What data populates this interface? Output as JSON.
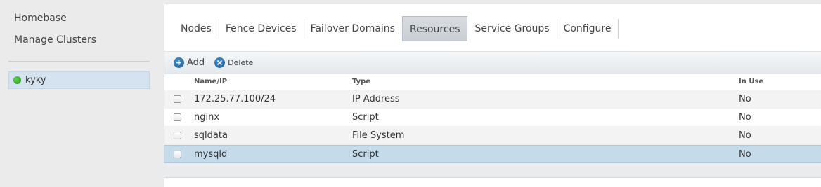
{
  "sidebar": {
    "links": [
      "Homebase",
      "Manage Clusters"
    ],
    "clusters": [
      {
        "name": "kyky",
        "status": "online"
      }
    ]
  },
  "tabs": [
    "Nodes",
    "Fence Devices",
    "Failover Domains",
    "Resources",
    "Service Groups",
    "Configure"
  ],
  "active_tab": "Resources",
  "toolbar": {
    "add_label": "Add",
    "add_icon": "plus-icon",
    "delete_label": "Delete",
    "delete_icon": "x-icon"
  },
  "table": {
    "columns": [
      "Name/IP",
      "Type",
      "In Use"
    ],
    "rows": [
      {
        "name": "172.25.77.100/24",
        "type": "IP Address",
        "in_use": "No"
      },
      {
        "name": "nginx",
        "type": "Script",
        "in_use": "No"
      },
      {
        "name": "sqldata",
        "type": "File System",
        "in_use": "No"
      },
      {
        "name": "mysqld",
        "type": "Script",
        "in_use": "No",
        "selected": true
      }
    ]
  },
  "colors": {
    "accent": "#1d5f9c",
    "status_online": "#1f9a14",
    "selection": "#c6dbea"
  }
}
